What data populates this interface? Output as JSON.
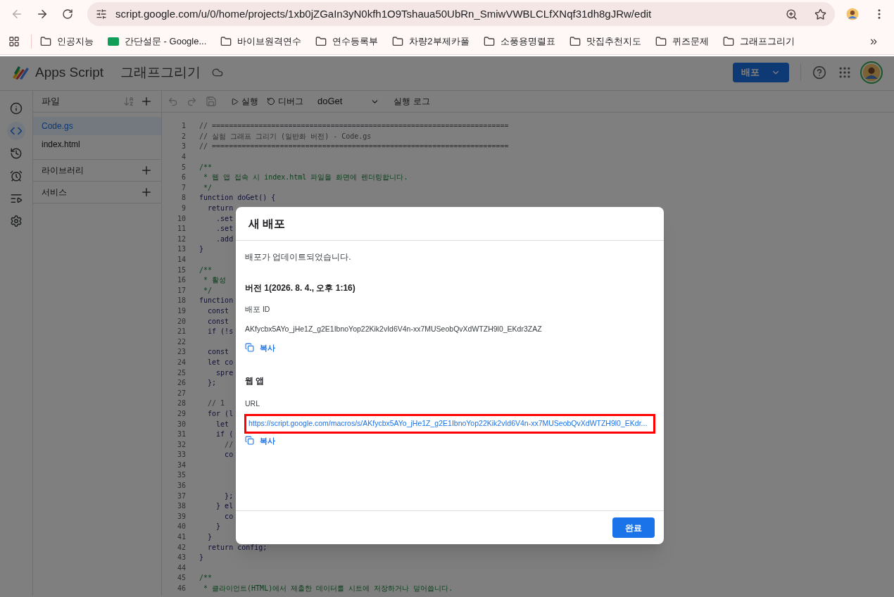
{
  "browser": {
    "url": "script.google.com/u/0/home/projects/1xb0jZGaIn3yN0kfh1O9Tshaua50UbRn_SmiwVWBLCLfXNqf31dh8gJRw/edit",
    "bookmarks": [
      {
        "label": "인공지능",
        "kind": "folder"
      },
      {
        "label": "간단설문 - Google...",
        "kind": "form"
      },
      {
        "label": "바이브원격연수",
        "kind": "folder"
      },
      {
        "label": "연수등록부",
        "kind": "folder"
      },
      {
        "label": "차량2부제카풀",
        "kind": "folder"
      },
      {
        "label": "소풍용명렬표",
        "kind": "folder"
      },
      {
        "label": "맛집추천지도",
        "kind": "folder"
      },
      {
        "label": "퀴즈문제",
        "kind": "folder"
      },
      {
        "label": "그래프그리기",
        "kind": "folder"
      }
    ],
    "more": "»"
  },
  "app": {
    "name": "Apps Script",
    "project": "그래프그리기",
    "deploy_button": "배포"
  },
  "rail": [
    {
      "selected": false
    },
    {
      "selected": true
    },
    {
      "selected": false
    },
    {
      "selected": false
    },
    {
      "selected": false
    },
    {
      "selected": false
    }
  ],
  "files_panel": {
    "title": "파일",
    "files": [
      {
        "name": "Code.gs",
        "selected": true
      },
      {
        "name": "index.html",
        "selected": false
      }
    ],
    "sections": [
      "라이브러리",
      "서비스"
    ]
  },
  "toolbar": {
    "run": "실행",
    "debug": "디버그",
    "function": "doGet",
    "log": "실행 로그"
  },
  "code": [
    {
      "n": "1",
      "text": "// ======================================================================",
      "kind": "comment"
    },
    {
      "n": "2",
      "text": "// 실험 그래프 그리기 (일반화 버전) - Code.gs",
      "kind": "comment"
    },
    {
      "n": "3",
      "text": "// ======================================================================",
      "kind": "comment"
    },
    {
      "n": "4"
    },
    {
      "n": "5",
      "text": "/**",
      "kind": "doc"
    },
    {
      "n": "6",
      "text": " * 웹 앱 접속 시 index.html 파일을 화면에 렌더링합니다.",
      "kind": "doc"
    },
    {
      "n": "7",
      "text": " */",
      "kind": "doc"
    },
    {
      "n": "8",
      "text": "function doGet() {",
      "kind": "code"
    },
    {
      "n": "9",
      "text": "  return",
      "kind": "code"
    },
    {
      "n": "10",
      "text": "    .set",
      "kind": "code"
    },
    {
      "n": "11",
      "text": "    .set",
      "kind": "code"
    },
    {
      "n": "12",
      "text": "    .add",
      "kind": "code"
    },
    {
      "n": "13",
      "text": "}",
      "kind": "code"
    },
    {
      "n": "14"
    },
    {
      "n": "15",
      "text": "/**",
      "kind": "doc"
    },
    {
      "n": "16",
      "text": " * 활성",
      "kind": "doc"
    },
    {
      "n": "17",
      "text": " */",
      "kind": "doc"
    },
    {
      "n": "18",
      "text": "function",
      "kind": "code"
    },
    {
      "n": "19",
      "text": "  const",
      "kind": "code"
    },
    {
      "n": "20",
      "text": "  const",
      "kind": "code"
    },
    {
      "n": "21",
      "text": "  if (!s",
      "kind": "code"
    },
    {
      "n": "22"
    },
    {
      "n": "23",
      "text": "  const",
      "kind": "code"
    },
    {
      "n": "24",
      "text": "  let co",
      "kind": "code"
    },
    {
      "n": "25",
      "text": "    spre",
      "kind": "code"
    },
    {
      "n": "26",
      "text": "  };",
      "kind": "code"
    },
    {
      "n": "27"
    },
    {
      "n": "28",
      "text": "  // 1",
      "kind": "comment"
    },
    {
      "n": "29",
      "text": "  for (l",
      "kind": "code"
    },
    {
      "n": "30",
      "text": "    let",
      "kind": "code"
    },
    {
      "n": "31",
      "text": "    if (",
      "kind": "code"
    },
    {
      "n": "32",
      "text": "      //",
      "kind": "comment"
    },
    {
      "n": "33",
      "text": "      co",
      "kind": "code"
    },
    {
      "n": "34"
    },
    {
      "n": "35"
    },
    {
      "n": "36"
    },
    {
      "n": "37",
      "text": "      };",
      "kind": "code"
    },
    {
      "n": "38",
      "text": "    } el",
      "kind": "code"
    },
    {
      "n": "39",
      "text": "      co",
      "kind": "code"
    },
    {
      "n": "40",
      "text": "    }",
      "kind": "code"
    },
    {
      "n": "41",
      "text": "  }",
      "kind": "code"
    },
    {
      "n": "42",
      "text": "  return config;",
      "kind": "code"
    },
    {
      "n": "43",
      "text": "}",
      "kind": "code"
    },
    {
      "n": "44"
    },
    {
      "n": "45",
      "text": "/**",
      "kind": "doc"
    },
    {
      "n": "46",
      "text": " * 클라이언트(HTML)에서 제출한 데이터를 시트에 저장하거나 덮어씁니다.",
      "kind": "doc"
    }
  ],
  "dialog": {
    "title": "새 배포",
    "message": "배포가 업데이트되었습니다.",
    "version": "버전 1(2026. 8. 4., 오후 1:16)",
    "id_label": "배포 ID",
    "deployment_id": "AKfycbx5AYo_jHe1Z_g2E1IbnoYop22Kik2vId6V4n-xx7MUSeobQvXdWTZH9l0_EKdr3ZAZ",
    "copy_id": "복사",
    "webapp_heading": "웹 앱",
    "url_label": "URL",
    "url": "https://script.google.com/macros/s/AKfycbx5AYo_jHe1Z_g2E1IbnoYop22Kik2vId6V4n-xx7MUSeobQvXdWTZH9l0_EKdr...",
    "url_highlighted": true,
    "copy_url": "복사",
    "done": "완료"
  }
}
